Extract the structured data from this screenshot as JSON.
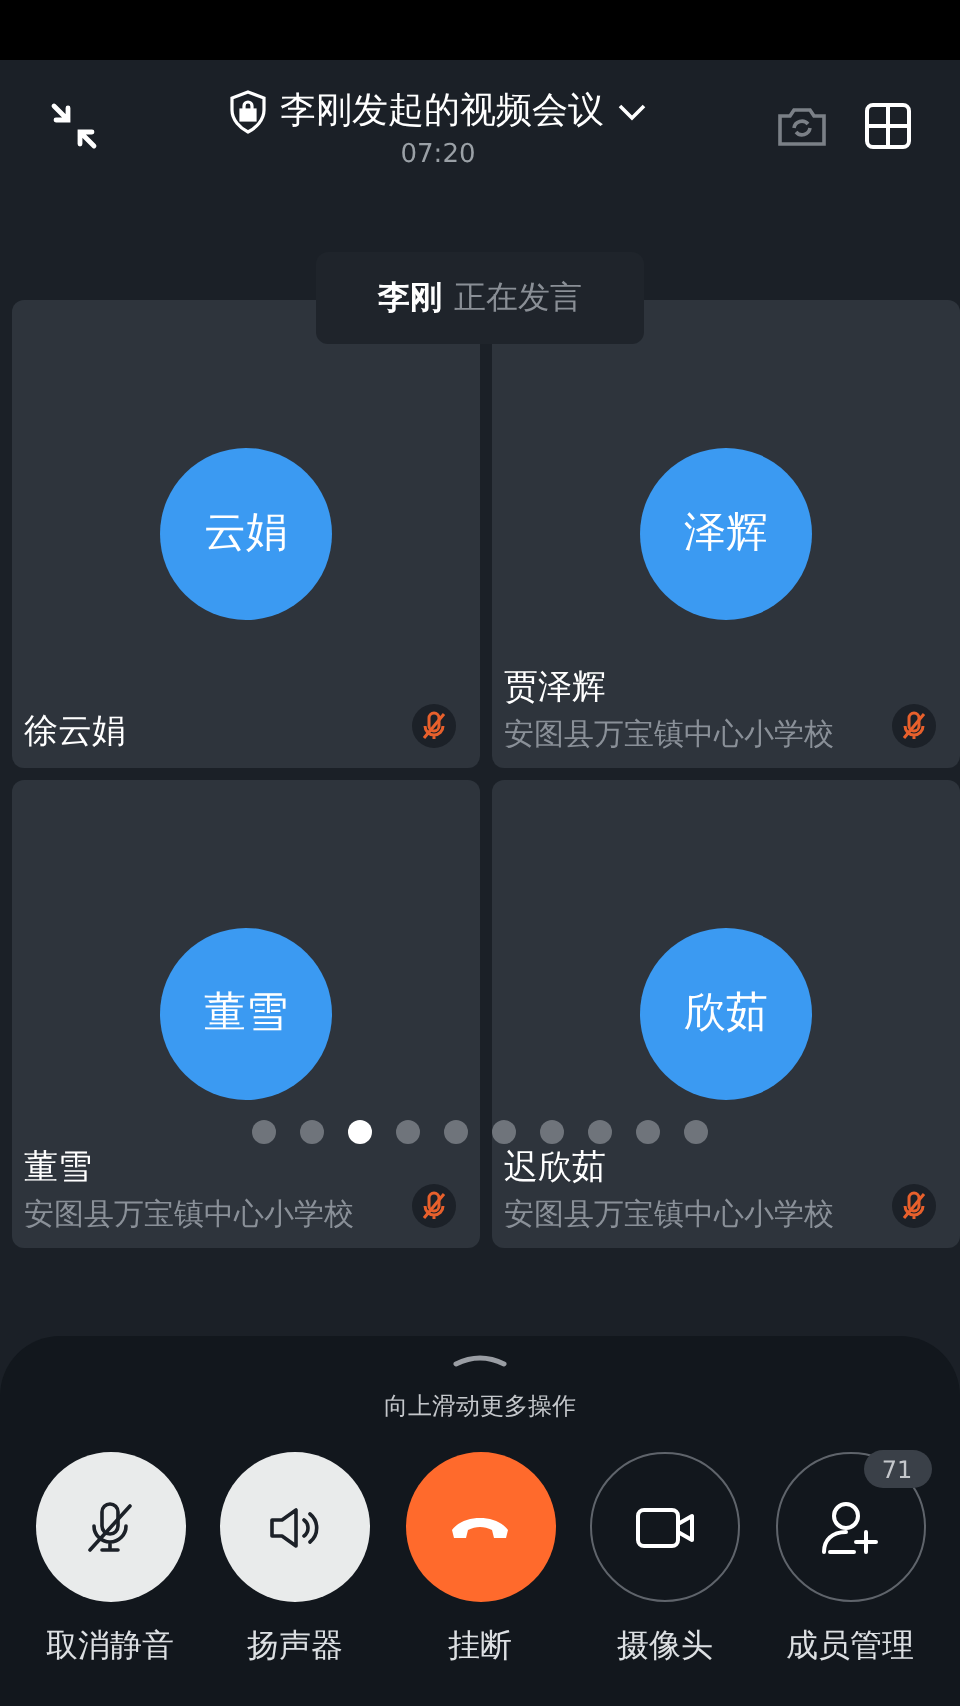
{
  "header": {
    "title": "李刚发起的视频会议",
    "time": "07:20"
  },
  "speaker_toast": {
    "name": "李刚",
    "status": "正在发言"
  },
  "tiles": [
    {
      "avatar": "云娟",
      "name": "徐云娟",
      "muted": true
    },
    {
      "avatar": "泽辉",
      "name": "贾泽辉",
      "org": "安图县万宝镇中心小学校",
      "muted": true
    },
    {
      "avatar": "董雪",
      "name": "董雪",
      "org": "安图县万宝镇中心小学校",
      "muted": true
    },
    {
      "avatar": "欣茹",
      "name": "迟欣茹",
      "org": "安图县万宝镇中心小学校",
      "muted": true
    }
  ],
  "pages": [
    {
      "selected": false
    },
    {
      "selected": false
    },
    {
      "selected": true
    },
    {
      "selected": false
    },
    {
      "selected": false
    },
    {
      "selected": false
    },
    {
      "selected": false
    },
    {
      "selected": false
    },
    {
      "selected": false
    },
    {
      "selected": false
    }
  ],
  "sheet": {
    "hint": "向上滑动更多操作"
  },
  "actions": [
    {
      "kind": "mic",
      "label": "取消静音"
    },
    {
      "kind": "speaker",
      "label": "扬声器"
    },
    {
      "kind": "hangup",
      "label": "挂断"
    },
    {
      "kind": "camera",
      "label": "摄像头"
    },
    {
      "kind": "members",
      "label": "成员管理",
      "badge": "71"
    }
  ]
}
